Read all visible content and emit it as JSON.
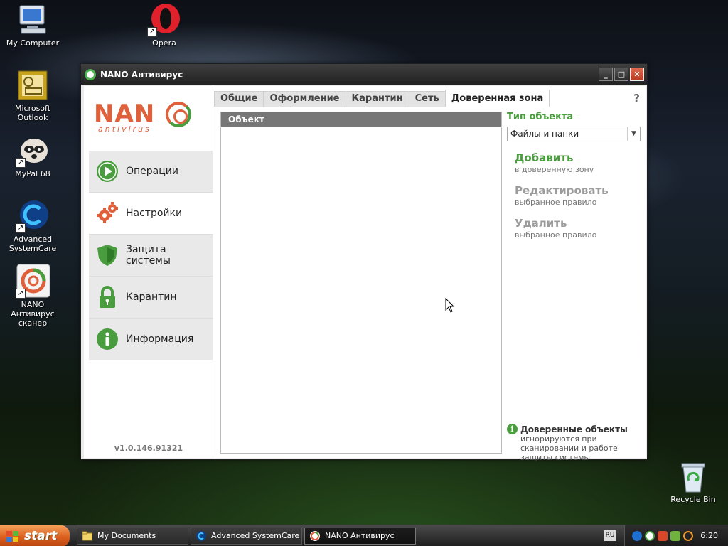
{
  "desktop": {
    "icons": [
      {
        "label": "My Computer"
      },
      {
        "label": "Opera"
      },
      {
        "label": "Microsoft Outlook"
      },
      {
        "label": "MyPal 68"
      },
      {
        "label": "Advanced SystemCare"
      },
      {
        "label": "NANO Антивирус сканер"
      },
      {
        "label": "Recycle Bin"
      }
    ]
  },
  "window": {
    "title": "NANO Антивирус",
    "logo_text": "NAN",
    "logo_sub": "antivirus",
    "version": "v1.0.146.91321",
    "nav": [
      {
        "label": "Операции",
        "icon": "play-icon"
      },
      {
        "label": "Настройки",
        "icon": "gears-icon"
      },
      {
        "label": "Защита системы",
        "icon": "shield-icon"
      },
      {
        "label": "Карантин",
        "icon": "lock-icon"
      },
      {
        "label": "Информация",
        "icon": "info-icon"
      }
    ],
    "active_nav": "Настройки",
    "tabs": [
      {
        "label": "Общие"
      },
      {
        "label": "Оформление"
      },
      {
        "label": "Карантин"
      },
      {
        "label": "Сеть"
      },
      {
        "label": "Доверенная зона"
      }
    ],
    "active_tab": "Доверенная зона",
    "help": "?",
    "list_header": "Объект",
    "object_type_label": "Тип объекта",
    "object_type_value": "Файлы и папки",
    "actions": [
      {
        "label": "Добавить",
        "sub": "в доверенную зону",
        "enabled": true
      },
      {
        "label": "Редактировать",
        "sub": "выбранное правило",
        "enabled": false
      },
      {
        "label": "Удалить",
        "sub": "выбранное правило",
        "enabled": false
      }
    ],
    "info_title": "Доверенные объекты",
    "info_text": "игнорируются при сканировании и работе защиты системы",
    "colors": {
      "brand_green": "#4a9d3e",
      "brand_orange": "#e0603b"
    }
  },
  "taskbar": {
    "start_label": "start",
    "tasks": [
      {
        "label": "My Documents",
        "icon": "folder-icon"
      },
      {
        "label": "Advanced SystemCare",
        "icon": "asc-icon"
      },
      {
        "label": "NANO Антивирус",
        "icon": "nano-icon"
      }
    ],
    "language": "RU",
    "clock": "6:20"
  }
}
